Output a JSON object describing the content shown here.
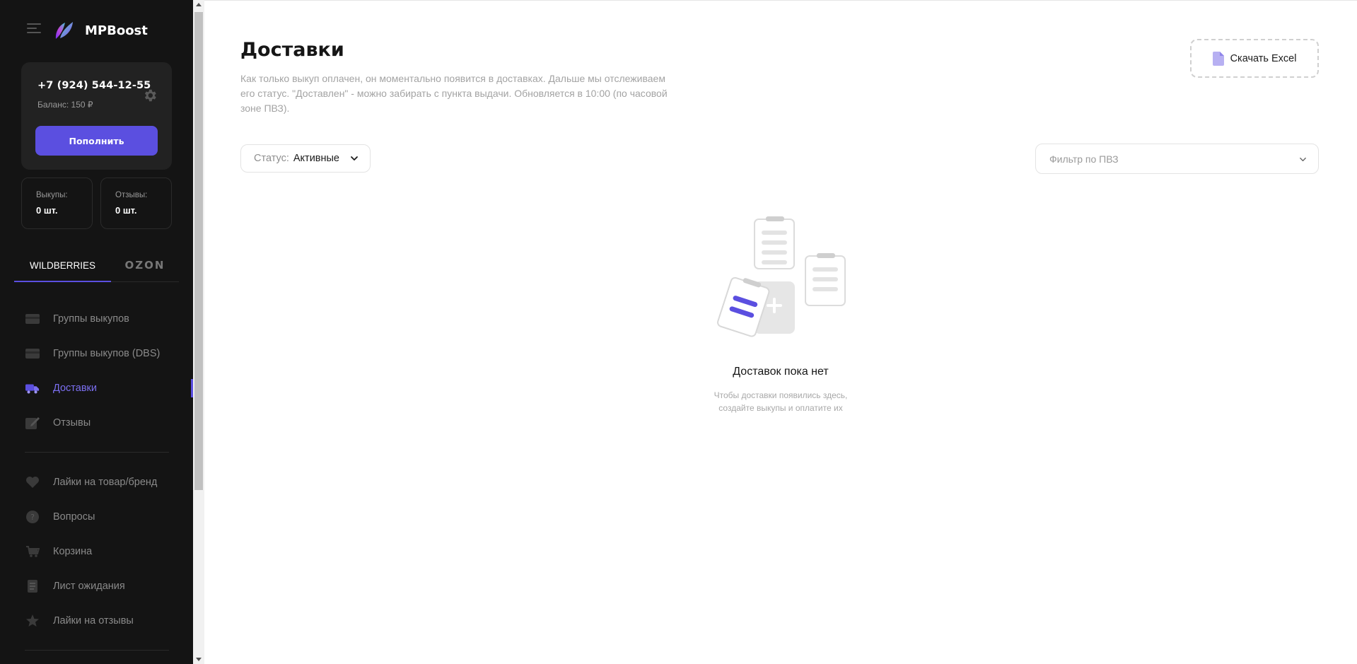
{
  "app": {
    "brand": "MPBoost",
    "colors": {
      "accent": "#5b4fe0",
      "sidebar_bg": "#141414",
      "card_bg": "#222222"
    }
  },
  "account": {
    "phone": "+7 (924) 544-12-55",
    "balance": "Баланс: 150 ₽",
    "topup_label": "Пополнить"
  },
  "stats": [
    {
      "label": "Выкупы:",
      "value": "0 шт."
    },
    {
      "label": "Отзывы:",
      "value": "0 шт."
    }
  ],
  "marketplace_tabs": [
    {
      "label": "WILDBERRIES",
      "active": true
    },
    {
      "label": "OZON",
      "active": false
    }
  ],
  "nav": {
    "group1": [
      {
        "label": "Группы выкупов",
        "icon": "card-icon"
      },
      {
        "label": "Группы выкупов (DBS)",
        "icon": "card-icon"
      },
      {
        "label": "Доставки",
        "icon": "truck-icon",
        "active": true
      },
      {
        "label": "Отзывы",
        "icon": "review-icon"
      }
    ],
    "group2": [
      {
        "label": "Лайки на товар/бренд",
        "icon": "heart-icon"
      },
      {
        "label": "Вопросы",
        "icon": "question-icon"
      },
      {
        "label": "Корзина",
        "icon": "cart-icon"
      },
      {
        "label": "Лист ожидания",
        "icon": "list-icon"
      },
      {
        "label": "Лайки на отзывы",
        "icon": "star-icon"
      }
    ]
  },
  "page": {
    "title": "Доставки",
    "description": "Как только выкуп оплачен, он моментально появится в доставках. Дальше мы отслеживаем его статус. \"Доставлен\" - можно забирать с пункта выдачи. Обновляется в 10:00 (по часовой зоне ПВЗ).",
    "excel_button": "Скачать Excel",
    "status_filter": {
      "prefix": "Статус:",
      "value": "Активные"
    },
    "pvz_filter": {
      "placeholder": "Фильтр по ПВЗ"
    }
  },
  "empty_state": {
    "title": "Доставок пока нет",
    "line1": "Чтобы доставки появились здесь,",
    "line2": "создайте выкупы и оплатите их"
  }
}
